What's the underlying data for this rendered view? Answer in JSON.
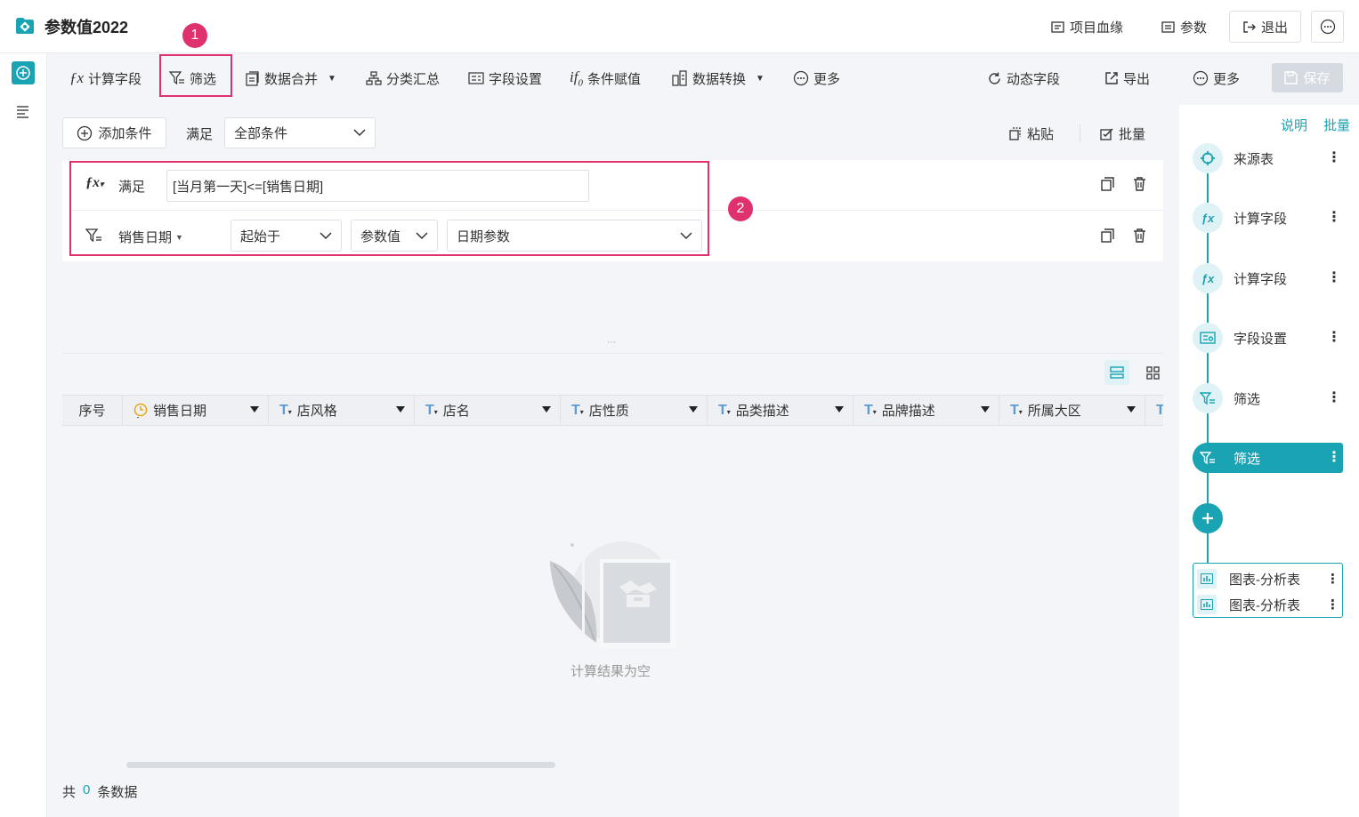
{
  "header": {
    "title": "参数值2022",
    "lineage_label": "项目血缘",
    "params_label": "参数",
    "exit_label": "退出"
  },
  "toolbar": {
    "calc_field": "计算字段",
    "filter": "筛选",
    "data_merge": "数据合并",
    "group_summary": "分类汇总",
    "field_settings": "字段设置",
    "conditional_assign": "条件赋值",
    "data_convert": "数据转换",
    "more_left": "更多",
    "dynamic_field": "动态字段",
    "export": "导出",
    "more_right": "更多",
    "save": "保存"
  },
  "filter_panel": {
    "add_condition": "添加条件",
    "satisfy_label": "满足",
    "satisfy_select": "全部条件",
    "paste": "粘贴",
    "batch": "批量",
    "conditions": [
      {
        "type_label": "满足",
        "formula": "[当月第一天]<=[销售日期]"
      },
      {
        "field": "销售日期",
        "operator": "起始于",
        "value_type": "参数值",
        "param": "日期参数"
      }
    ]
  },
  "table": {
    "columns": [
      {
        "label": "序号",
        "icon": ""
      },
      {
        "label": "销售日期",
        "icon": "clock-icon"
      },
      {
        "label": "店风格",
        "icon": "text-type-icon"
      },
      {
        "label": "店名",
        "icon": "text-type-icon"
      },
      {
        "label": "店性质",
        "icon": "text-type-icon"
      },
      {
        "label": "品类描述",
        "icon": "text-type-icon"
      },
      {
        "label": "品牌描述",
        "icon": "text-type-icon"
      },
      {
        "label": "所属大区",
        "icon": "text-type-icon"
      }
    ],
    "empty_text": "计算结果为空",
    "footer_prefix": "共",
    "footer_count": "0",
    "footer_suffix": "条数据"
  },
  "flow": {
    "explain_link": "说明",
    "batch_link": "批量",
    "steps": [
      {
        "label": "来源表",
        "icon": "crosshair-icon"
      },
      {
        "label": "计算字段",
        "icon": "fx-icon"
      },
      {
        "label": "计算字段",
        "icon": "fx-icon"
      },
      {
        "label": "字段设置",
        "icon": "field-settings-icon"
      },
      {
        "label": "筛选",
        "icon": "filter-icon"
      },
      {
        "label": "筛选",
        "icon": "filter-icon",
        "active": true
      }
    ],
    "charts": [
      {
        "label": "图表-分析表"
      },
      {
        "label": "图表-分析表"
      }
    ]
  },
  "annotations": {
    "badge1": "1",
    "badge2": "2"
  },
  "colors": {
    "accent": "#19a3b3",
    "annotation": "#e0316f"
  }
}
